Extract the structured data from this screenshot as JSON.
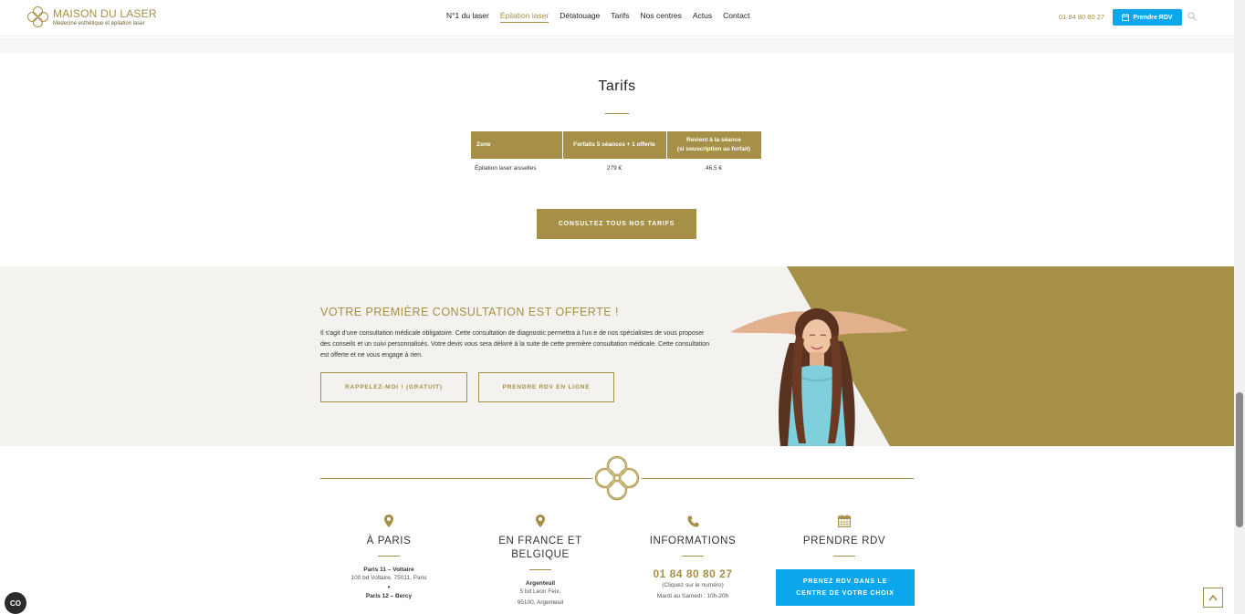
{
  "header": {
    "brand": "MAISON DU LASER",
    "tagline": "Médecine esthétique et épilation laser",
    "nav": [
      {
        "label": "N°1 du laser"
      },
      {
        "label": "Épilation laser"
      },
      {
        "label": "Détatouage"
      },
      {
        "label": "Tarifs"
      },
      {
        "label": "Nos centres"
      },
      {
        "label": "Actus"
      },
      {
        "label": "Contact"
      }
    ],
    "phone": "01 84 80 80 27",
    "rdv_label": "Prendre RDV"
  },
  "tarifs": {
    "title": "Tarifs",
    "table": {
      "headers": [
        "Zone",
        "Forfaits 5 séances + 1 offerte",
        "Revient à la séance",
        "(si souscription au forfait)"
      ],
      "rows": [
        [
          "Épilation laser aisselles",
          "279 €",
          "46,5 €"
        ]
      ]
    },
    "cta": "CONSULTEZ TOUS NOS TARIFS"
  },
  "consultation": {
    "title": "VOTRE PREMIÈRE CONSULTATION EST OFFERTE !",
    "text": "Il s'agit d'une consultation médicale obligatoire. Cette consultation de diagnostic permettra à l'un.e de nos spécialistes de vous proposer des conseils et un suivi personnalisés. Votre devis vous sera délivré à la suite de cette première consultation médicale. Cette consultation est offerte et ne vous engage à rien.",
    "btn_call": "RAPPELEZ-MOI ! (GRATUIT)",
    "btn_online": "PRENDRE RDV EN LIGNE"
  },
  "footer": {
    "paris": {
      "title": "À PARIS",
      "c1_name": "Paris 11 – Voltaire",
      "c1_addr": "100 bd Voltaire, 75011, Paris",
      "c2_name": "Paris 12 – Bercy"
    },
    "france": {
      "title_l1": "EN FRANCE ET",
      "title_l2": "BELGIQUE",
      "c1_name": "Argenteuil",
      "c1_addr1": "5 bd Leon Feix,",
      "c1_addr2": "95100, Argenteuil"
    },
    "info": {
      "title": "INFORMATIONS",
      "phone": "01 84 80 80 27",
      "click": "(Cliquez sur le numéro)",
      "hours": "Mardi au Samedi : 10h-20h"
    },
    "rdv": {
      "title": "PRENDRE RDV",
      "cta_l1": "PRENEZ RDV DANS LE",
      "cta_l2": "CENTRE DE VOTRE CHOIX"
    }
  },
  "cookie_label": "CO",
  "colors": {
    "gold": "#a68f46",
    "blue": "#0aa7ec",
    "band": "#f3f2ef"
  }
}
